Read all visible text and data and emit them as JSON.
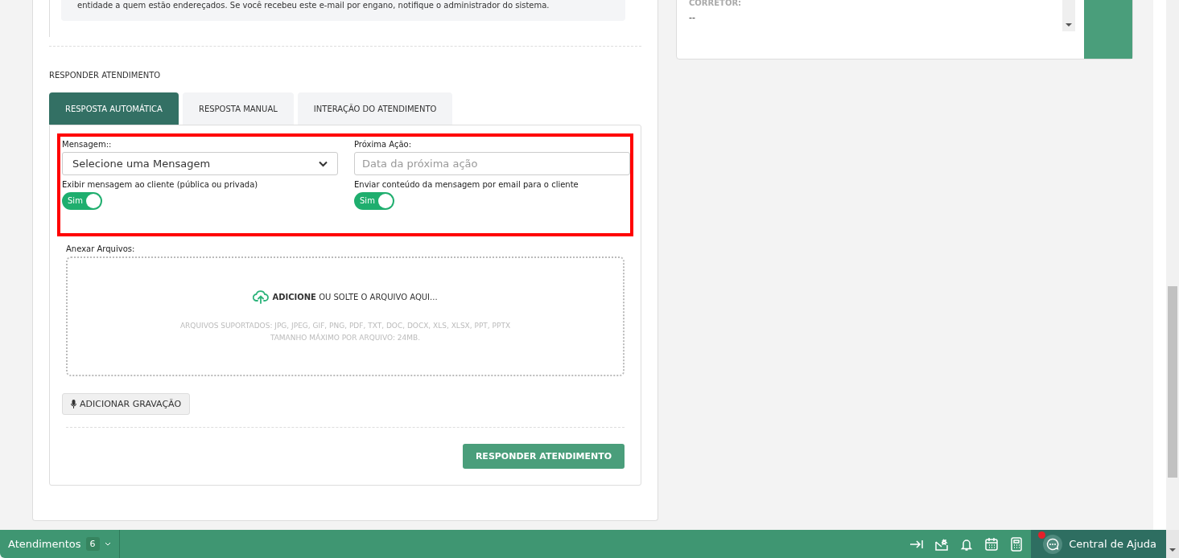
{
  "email_notice": {
    "text": "entidade a quem estão endereçados. Se você recebeu este e-mail por engano, notifique o administrador do sistema."
  },
  "side_panel": {
    "label": "CORRETOR:",
    "value": "--"
  },
  "reply_section": {
    "title": "RESPONDER ATENDIMENTO",
    "tabs": [
      {
        "label": "RESPOSTA AUTOMÁTICA",
        "selected": true
      },
      {
        "label": "RESPOSTA MANUAL",
        "selected": false
      },
      {
        "label": "INTERAÇÃO DO ATENDIMENTO",
        "selected": false
      }
    ],
    "form": {
      "highlighted": true,
      "message_select": {
        "label": "Mensagem::",
        "value": "Selecione uma Mensagem"
      },
      "next_action": {
        "label": "Próxima Ação:",
        "placeholder": "Data da próxima ação"
      },
      "toggles": [
        {
          "label": "Exibir mensagem ao cliente (pública ou privada)",
          "value_label": "Sim",
          "on": true
        },
        {
          "label": "Enviar conteúdo da mensagem por email para o cliente",
          "value_label": "Sim",
          "on": true
        }
      ]
    },
    "attachments": {
      "label": "Anexar Arquivos:",
      "drop_text": "**ADICIONE** OU SOLTE O ARQUIVO AQUI...",
      "supported": "ARQUIVOS SUPORTADOS: JPG, JPEG, GIF, PNG, PDF, TXT, DOC, DOCX, XLS, XLSX, PPT, PPTX",
      "max_size": "TAMANHO MÁXIMO POR ARQUIVO: 24MB."
    },
    "record_button": "ADICIONAR GRAVAÇÃO",
    "submit_button": "RESPONDER ATENDIMENTO"
  },
  "bottom_bar": {
    "queue": {
      "label": "Atendimentos",
      "count": "6"
    },
    "help": {
      "label": "Central de Ajuda",
      "notification": true
    }
  }
}
